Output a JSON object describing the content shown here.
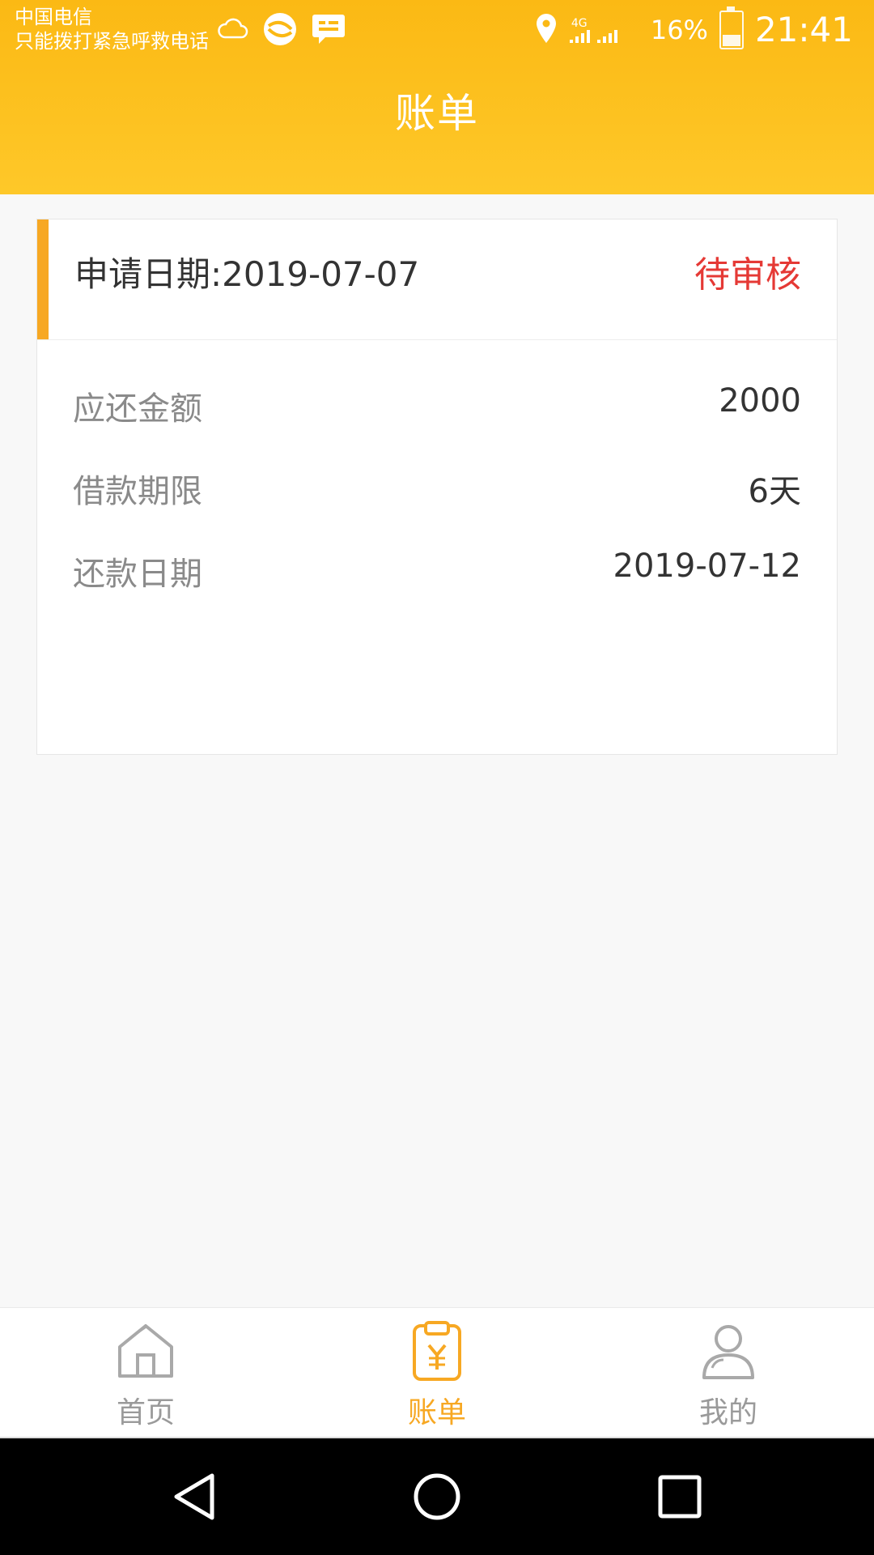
{
  "status_bar": {
    "carrier_line1": "中国电信",
    "carrier_line2": "只能拨打紧急呼救电话",
    "network": "4G",
    "battery_percent": "16%",
    "time": "21:41",
    "icons": [
      "cloud-icon",
      "sync-icon",
      "message-icon",
      "location-icon",
      "signal-icon",
      "battery-icon"
    ]
  },
  "header": {
    "title": "账单"
  },
  "bill_card": {
    "apply_date_label": "申请日期:2019-07-07",
    "status": "待审核",
    "rows": [
      {
        "label": "应还金额",
        "value": "2000"
      },
      {
        "label": "借款期限",
        "value": "6天"
      },
      {
        "label": "还款日期",
        "value": "2019-07-12"
      }
    ]
  },
  "tabbar": {
    "tabs": [
      {
        "label": "首页",
        "icon": "home-icon"
      },
      {
        "label": "账单",
        "icon": "bill-icon"
      },
      {
        "label": "我的",
        "icon": "profile-icon"
      }
    ],
    "active_index": 1
  },
  "colors": {
    "header_top": "#fbb914",
    "header_bottom": "#fec829",
    "accent": "#f7a823",
    "status_red": "#e53935"
  },
  "system_nav": {
    "icons": [
      "back-icon",
      "home-circle-icon",
      "recents-icon"
    ]
  }
}
